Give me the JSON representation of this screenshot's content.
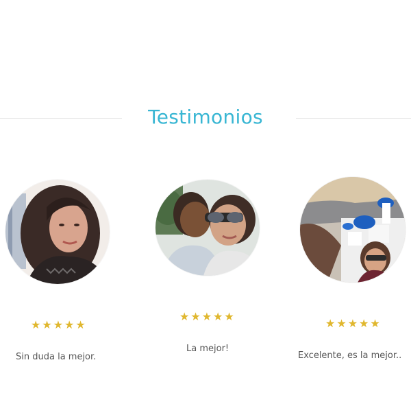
{
  "section": {
    "title": "Testimonios"
  },
  "testimonials": [
    {
      "avatar_icon": "woman-portrait",
      "stars": "★★★★★",
      "rating": 5,
      "quote": "Sin duda la mejor."
    },
    {
      "avatar_icon": "mother-child-portrait",
      "stars": "★★★★★",
      "rating": 5,
      "quote": "La mejor!"
    },
    {
      "avatar_icon": "travel-santorini-portrait",
      "stars": "★★★★★",
      "rating": 5,
      "quote": "Excelente, es la mejor.."
    }
  ],
  "colors": {
    "accent": "#38b6d3",
    "star": "#e0b72e",
    "text": "#555555",
    "rule": "#e6e6e6"
  }
}
